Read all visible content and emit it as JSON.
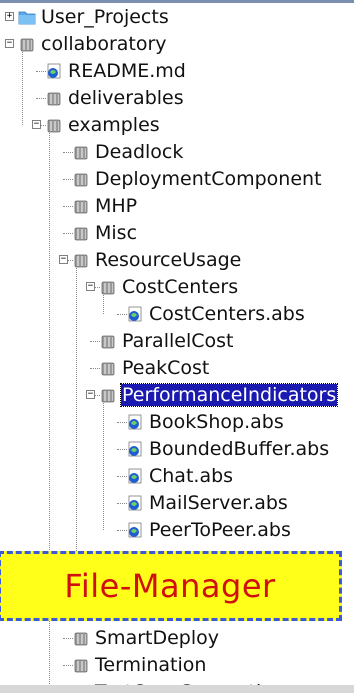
{
  "tree": [
    {
      "label": "User_Projects",
      "level": 0,
      "icon": "folder-icon",
      "expander": "plus"
    },
    {
      "label": "collaboratory",
      "level": 0,
      "icon": "database-icon",
      "expander": "minus"
    },
    {
      "label": "README.md",
      "level": 1,
      "icon": "file-icon",
      "expander": "none"
    },
    {
      "label": "deliverables",
      "level": 1,
      "icon": "database-icon",
      "expander": "none"
    },
    {
      "label": "examples",
      "level": 1,
      "icon": "database-icon",
      "expander": "minus"
    },
    {
      "label": "Deadlock",
      "level": 2,
      "icon": "database-icon",
      "expander": "none"
    },
    {
      "label": "DeploymentComponent",
      "level": 2,
      "icon": "database-icon",
      "expander": "none"
    },
    {
      "label": "MHP",
      "level": 2,
      "icon": "database-icon",
      "expander": "none"
    },
    {
      "label": "Misc",
      "level": 2,
      "icon": "database-icon",
      "expander": "none"
    },
    {
      "label": "ResourceUsage",
      "level": 2,
      "icon": "database-icon",
      "expander": "minus"
    },
    {
      "label": "CostCenters",
      "level": 3,
      "icon": "database-icon",
      "expander": "minus"
    },
    {
      "label": "CostCenters.abs",
      "level": 4,
      "icon": "file-icon",
      "expander": "none"
    },
    {
      "label": "ParallelCost",
      "level": 3,
      "icon": "database-icon",
      "expander": "none"
    },
    {
      "label": "PeakCost",
      "level": 3,
      "icon": "database-icon",
      "expander": "none"
    },
    {
      "label": "PerformanceIndicators",
      "level": 3,
      "icon": "database-icon",
      "expander": "minus",
      "selected": true
    },
    {
      "label": "BookShop.abs",
      "level": 4,
      "icon": "file-icon",
      "expander": "none"
    },
    {
      "label": "BoundedBuffer.abs",
      "level": 4,
      "icon": "file-icon",
      "expander": "none"
    },
    {
      "label": "Chat.abs",
      "level": 4,
      "icon": "file-icon",
      "expander": "none"
    },
    {
      "label": "MailServer.abs",
      "level": 4,
      "icon": "file-icon",
      "expander": "none"
    },
    {
      "label": "PeerToPeer.abs",
      "level": 4,
      "icon": "file-icon",
      "expander": "none"
    },
    {
      "label": "",
      "level": 3,
      "icon": "database-icon",
      "expander": "none"
    },
    {
      "label": "",
      "level": 2,
      "icon": "database-icon",
      "expander": "none"
    },
    {
      "label": "",
      "level": 2,
      "icon": "database-icon",
      "expander": "none"
    },
    {
      "label": "SmartDeploy",
      "level": 2,
      "icon": "database-icon",
      "expander": "none"
    },
    {
      "label": "Termination",
      "level": 2,
      "icon": "database-icon",
      "expander": "none"
    },
    {
      "label": "TestCaseGeneration",
      "level": 2,
      "icon": "database-icon",
      "expander": "none"
    }
  ],
  "overlay": {
    "text": "File-Manager"
  }
}
